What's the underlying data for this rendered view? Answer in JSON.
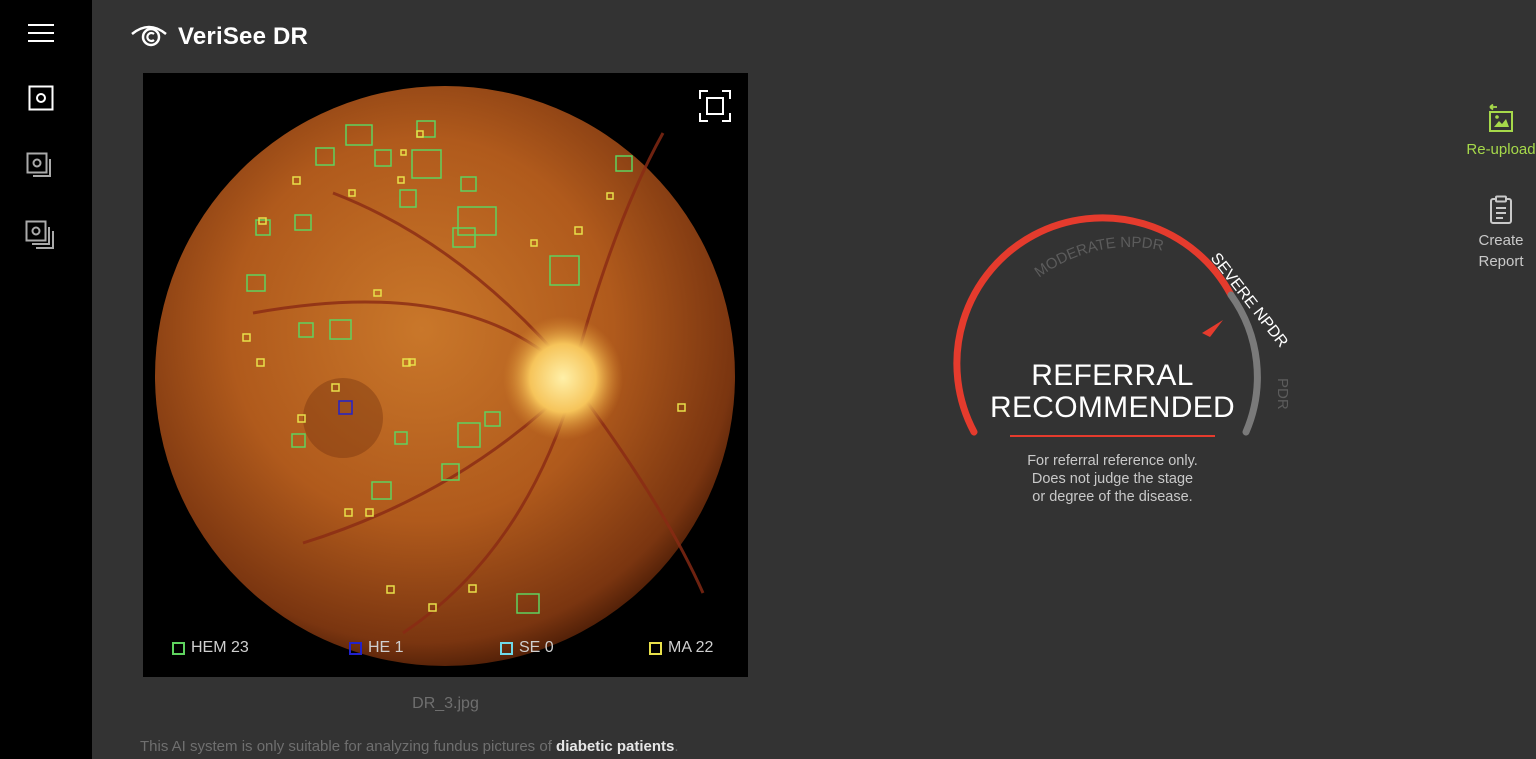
{
  "app": {
    "title": "VeriSee DR"
  },
  "nav": {
    "menu_icon": "hamburger-menu-icon",
    "items": [
      {
        "name": "single-image-icon",
        "active": true
      },
      {
        "name": "multi-image-icon",
        "active": false
      },
      {
        "name": "batch-image-icon",
        "active": false
      }
    ]
  },
  "viewer": {
    "filename": "DR_3.jpg",
    "legend": [
      {
        "label": "HEM 23",
        "color": "#5fd35f"
      },
      {
        "label": "HE 1",
        "color": "#2222cc"
      },
      {
        "label": "SE 0",
        "color": "#6fd8e8"
      },
      {
        "label": "MA 22",
        "color": "#e8e04a"
      }
    ]
  },
  "disclaimer": {
    "prefix": "This AI system is only suitable for analyzing fundus pictures of ",
    "emphasis": "diabetic patients",
    "suffix": "."
  },
  "result": {
    "scale": [
      "MODERATE NPDR",
      "SEVERE NPDR",
      "PDR"
    ],
    "current_stage": "SEVERE NPDR",
    "verdict_line1": "REFERRAL",
    "verdict_line2": "RECOMMENDED",
    "note_line1": "For referral reference only.",
    "note_line2": "Does not judge the stage",
    "note_line3": "or degree of the disease."
  },
  "actions": {
    "reupload_label": "Re-upload",
    "report_label_1": "Create",
    "report_label_2": "Report"
  },
  "colors": {
    "accent": "#a6d94a",
    "alert": "#e53b2d",
    "background": "#333333",
    "rail": "#000000"
  }
}
